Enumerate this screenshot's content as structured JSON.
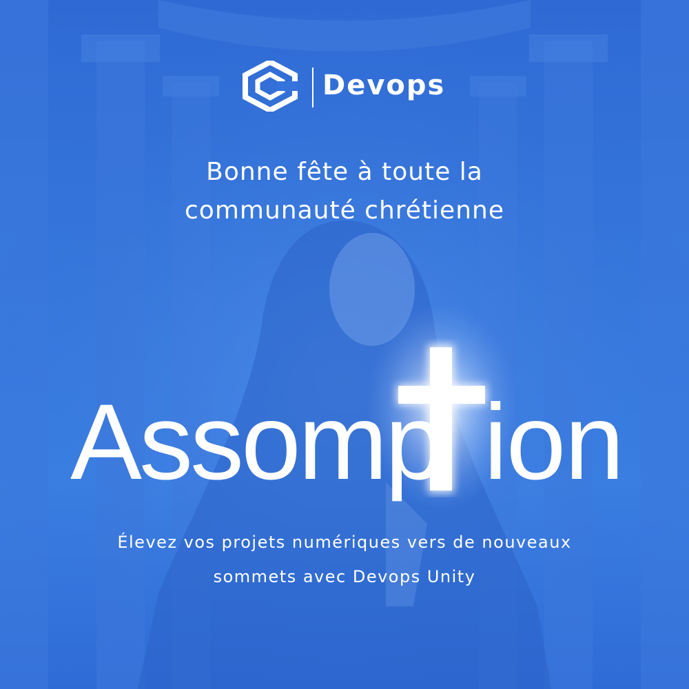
{
  "brand": {
    "name": "Devops",
    "logo_icon": "hexagon-logo-icon"
  },
  "greeting": {
    "line1": "Bonne fête à toute la",
    "line2": "communauté chrétienne"
  },
  "title": {
    "prefix": "Assomp",
    "suffix": "ion",
    "cross_icon": "glowing-cross-icon"
  },
  "tagline": {
    "line1": "Élevez vos projets numériques vers de nouveaux",
    "line2": "sommets avec Devops Unity"
  },
  "colors": {
    "background": "#2f6bd6",
    "text": "#ffffff"
  }
}
